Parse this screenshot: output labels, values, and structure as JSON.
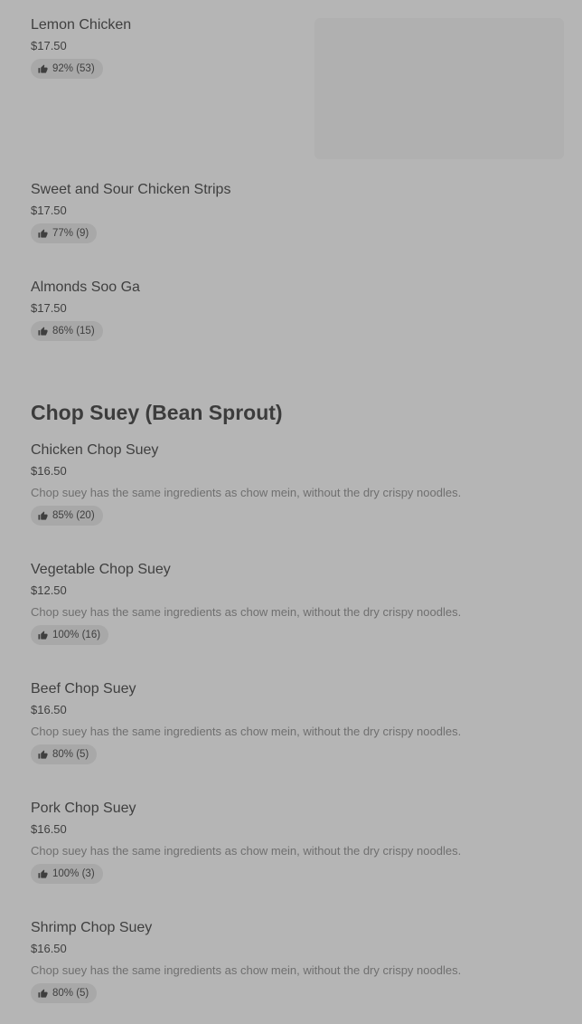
{
  "items_top": [
    {
      "name": "Lemon Chicken",
      "price": "$17.50",
      "rating": "92% (53)"
    },
    {
      "name": "Sweet and Sour Chicken Strips",
      "price": "$17.50",
      "rating": "77% (9)"
    },
    {
      "name": "Almonds Soo Ga",
      "price": "$17.50",
      "rating": "86% (15)"
    }
  ],
  "section": {
    "title": "Chop Suey (Bean Sprout)",
    "items": [
      {
        "name": "Chicken Chop Suey",
        "price": "$16.50",
        "description": "Chop suey has the same ingredients as chow mein, without the dry crispy noodles.",
        "rating": "85% (20)"
      },
      {
        "name": "Vegetable Chop Suey",
        "price": "$12.50",
        "description": "Chop suey has the same ingredients as chow mein, without the dry crispy noodles.",
        "rating": "100% (16)"
      },
      {
        "name": "Beef Chop Suey",
        "price": "$16.50",
        "description": "Chop suey has the same ingredients as chow mein, without the dry crispy noodles.",
        "rating": "80% (5)"
      },
      {
        "name": "Pork Chop Suey",
        "price": "$16.50",
        "description": "Chop suey has the same ingredients as chow mein, without the dry crispy noodles.",
        "rating": "100% (3)"
      },
      {
        "name": "Shrimp Chop Suey",
        "price": "$16.50",
        "description": "Chop suey has the same ingredients as chow mein, without the dry crispy noodles.",
        "rating": "80% (5)"
      }
    ]
  },
  "icons": {
    "rating": "thumbs-up-icon"
  }
}
